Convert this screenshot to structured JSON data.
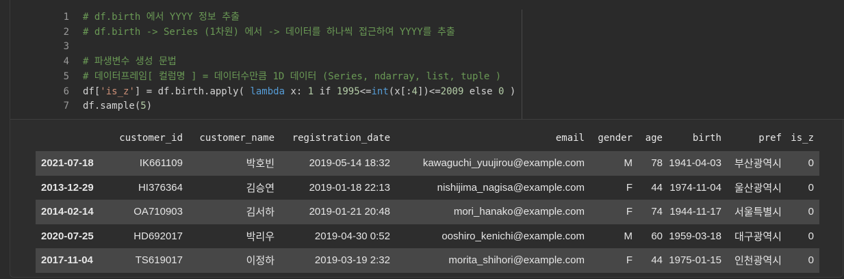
{
  "code": {
    "lines": [
      {
        "n": "1",
        "text": "# df.birth 에서 YYYY 정보 추출",
        "type": "comment"
      },
      {
        "n": "2",
        "text": "# df.birth -> Series (1차원) 에서 -> 데이터를 하나씩 접근하여 YYYY를 추출",
        "type": "comment"
      },
      {
        "n": "3",
        "text": "",
        "type": "plain"
      },
      {
        "n": "4",
        "text": "# 파생변수 생성 문법",
        "type": "comment"
      },
      {
        "n": "5",
        "text": "# 데이터프레임[ 컬럼명 ] = 데이터수만큼 1D 데이터 (Series, ndarray, list, tuple )",
        "type": "comment"
      },
      {
        "n": "6",
        "text": "df['is_z'] = df.birth.apply( lambda x: 1 if 1995<=int(x[:4])<=2009 else 0 )",
        "type": "code"
      },
      {
        "n": "7",
        "text": "df.sample(5)",
        "type": "code"
      }
    ]
  },
  "table": {
    "columns": [
      "",
      "customer_id",
      "customer_name",
      "registration_date",
      "email",
      "gender",
      "age",
      "birth",
      "pref",
      "is_z"
    ],
    "rows": [
      [
        "2021-07-18",
        "IK661109",
        "박호빈",
        "2019-05-14 18:32",
        "kawaguchi_yuujirou@example.com",
        "M",
        "78",
        "1941-04-03",
        "부산광역시",
        "0"
      ],
      [
        "2013-12-29",
        "HI376364",
        "김승연",
        "2019-01-18 22:13",
        "nishijima_nagisa@example.com",
        "F",
        "44",
        "1974-11-04",
        "울산광역시",
        "0"
      ],
      [
        "2014-02-14",
        "OA710903",
        "김서하",
        "2019-01-21 20:48",
        "mori_hanako@example.com",
        "F",
        "74",
        "1944-11-17",
        "서울특별시",
        "0"
      ],
      [
        "2020-07-25",
        "HD692017",
        "박리우",
        "2019-04-30 0:52",
        "ooshiro_kenichi@example.com",
        "M",
        "60",
        "1959-03-18",
        "대구광역시",
        "0"
      ],
      [
        "2017-11-04",
        "TS619017",
        "이정하",
        "2019-03-19 2:32",
        "morita_shihori@example.com",
        "F",
        "44",
        "1975-01-15",
        "인천광역시",
        "0"
      ]
    ]
  }
}
